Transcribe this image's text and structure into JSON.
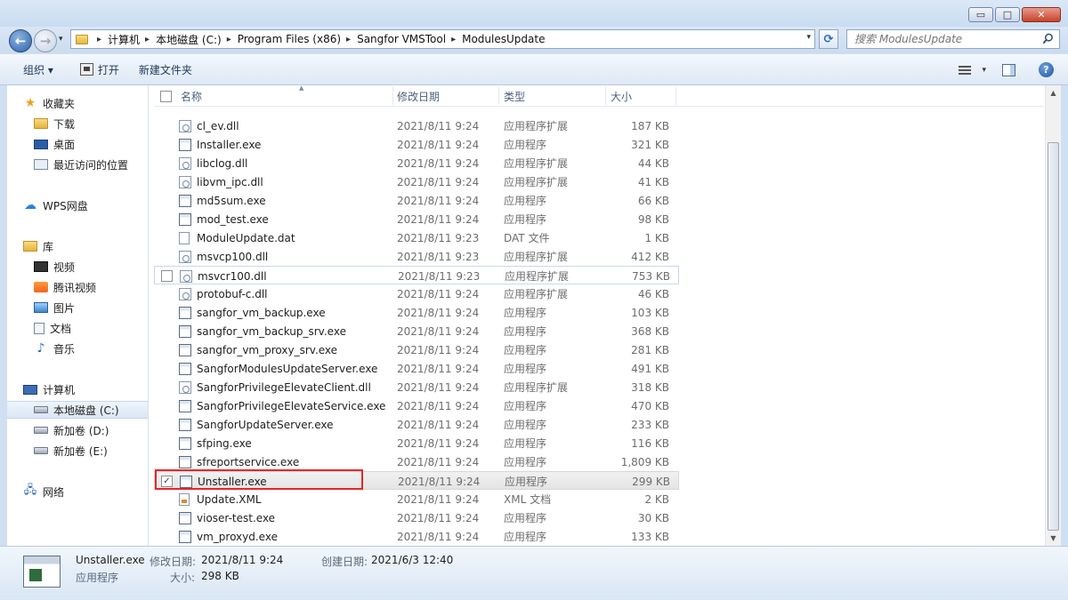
{
  "window": {
    "buttons": {
      "minimize": "▭",
      "maximize": "□",
      "close": "✕"
    }
  },
  "address": {
    "back": "←",
    "forward": "→",
    "breadcrumbs": [
      "计算机",
      "本地磁盘 (C:)",
      "Program Files (x86)",
      "Sangfor VMSTool",
      "ModulesUpdate"
    ],
    "refresh": "⟳",
    "search_placeholder": "搜索 ModulesUpdate"
  },
  "toolbar": {
    "organize": "组织 ▾",
    "open": "打开",
    "new_folder": "新建文件夹",
    "help": "?"
  },
  "sidebar": {
    "items": [
      {
        "label": "收藏夹"
      },
      {
        "label": "下载"
      },
      {
        "label": "桌面"
      },
      {
        "label": "最近访问的位置"
      },
      {
        "label": "WPS网盘"
      },
      {
        "label": "库"
      },
      {
        "label": "视频"
      },
      {
        "label": "腾讯视频"
      },
      {
        "label": "图片"
      },
      {
        "label": "文档"
      },
      {
        "label": "音乐"
      },
      {
        "label": "计算机"
      },
      {
        "label": "本地磁盘 (C:)"
      },
      {
        "label": "新加卷 (D:)"
      },
      {
        "label": "新加卷 (E:)"
      },
      {
        "label": "网络"
      }
    ]
  },
  "columns": {
    "name": "名称",
    "date": "修改日期",
    "type": "类型",
    "size": "大小"
  },
  "files": [
    {
      "name": "cl_ev.dll",
      "date": "2021/8/11 9:24",
      "type": "应用程序扩展",
      "size": "187 KB",
      "icon": "dll"
    },
    {
      "name": "Installer.exe",
      "date": "2021/8/11 9:24",
      "type": "应用程序",
      "size": "321 KB",
      "icon": "exe"
    },
    {
      "name": "libclog.dll",
      "date": "2021/8/11 9:24",
      "type": "应用程序扩展",
      "size": "44 KB",
      "icon": "dll"
    },
    {
      "name": "libvm_ipc.dll",
      "date": "2021/8/11 9:24",
      "type": "应用程序扩展",
      "size": "41 KB",
      "icon": "dll"
    },
    {
      "name": "md5sum.exe",
      "date": "2021/8/11 9:24",
      "type": "应用程序",
      "size": "66 KB",
      "icon": "exe"
    },
    {
      "name": "mod_test.exe",
      "date": "2021/8/11 9:24",
      "type": "应用程序",
      "size": "98 KB",
      "icon": "exe"
    },
    {
      "name": "ModuleUpdate.dat",
      "date": "2021/8/11 9:23",
      "type": "DAT 文件",
      "size": "1 KB",
      "icon": "dat"
    },
    {
      "name": "msvcp100.dll",
      "date": "2021/8/11 9:23",
      "type": "应用程序扩展",
      "size": "412 KB",
      "icon": "dll"
    },
    {
      "name": "msvcr100.dll",
      "date": "2021/8/11 9:23",
      "type": "应用程序扩展",
      "size": "753 KB",
      "icon": "dll"
    },
    {
      "name": "protobuf-c.dll",
      "date": "2021/8/11 9:24",
      "type": "应用程序扩展",
      "size": "46 KB",
      "icon": "dll"
    },
    {
      "name": "sangfor_vm_backup.exe",
      "date": "2021/8/11 9:24",
      "type": "应用程序",
      "size": "103 KB",
      "icon": "exe"
    },
    {
      "name": "sangfor_vm_backup_srv.exe",
      "date": "2021/8/11 9:24",
      "type": "应用程序",
      "size": "368 KB",
      "icon": "exe"
    },
    {
      "name": "sangfor_vm_proxy_srv.exe",
      "date": "2021/8/11 9:24",
      "type": "应用程序",
      "size": "281 KB",
      "icon": "exe"
    },
    {
      "name": "SangforModulesUpdateServer.exe",
      "date": "2021/8/11 9:24",
      "type": "应用程序",
      "size": "491 KB",
      "icon": "exe"
    },
    {
      "name": "SangforPrivilegeElevateClient.dll",
      "date": "2021/8/11 9:24",
      "type": "应用程序扩展",
      "size": "318 KB",
      "icon": "dll"
    },
    {
      "name": "SangforPrivilegeElevateService.exe",
      "date": "2021/8/11 9:24",
      "type": "应用程序",
      "size": "470 KB",
      "icon": "exe"
    },
    {
      "name": "SangforUpdateServer.exe",
      "date": "2021/8/11 9:24",
      "type": "应用程序",
      "size": "233 KB",
      "icon": "exe"
    },
    {
      "name": "sfping.exe",
      "date": "2021/8/11 9:24",
      "type": "应用程序",
      "size": "116 KB",
      "icon": "exe"
    },
    {
      "name": "sfreportservice.exe",
      "date": "2021/8/11 9:24",
      "type": "应用程序",
      "size": "1,809 KB",
      "icon": "exe"
    },
    {
      "name": "Unstaller.exe",
      "date": "2021/8/11 9:24",
      "type": "应用程序",
      "size": "299 KB",
      "icon": "exe"
    },
    {
      "name": "Update.XML",
      "date": "2021/8/11 9:24",
      "type": "XML 文档",
      "size": "2 KB",
      "icon": "xml"
    },
    {
      "name": "vioser-test.exe",
      "date": "2021/8/11 9:24",
      "type": "应用程序",
      "size": "30 KB",
      "icon": "exe"
    },
    {
      "name": "vm_proxyd.exe",
      "date": "2021/8/11 9:24",
      "type": "应用程序",
      "size": "133 KB",
      "icon": "exe"
    }
  ],
  "selected_check": "✓",
  "details": {
    "name": "Unstaller.exe",
    "modified_label": "修改日期:",
    "modified": "2021/8/11 9:24",
    "created_label": "创建日期:",
    "created": "2021/6/3 12:40",
    "type": "应用程序",
    "size_label": "大小:",
    "size": "298 KB"
  },
  "scrollbar": {
    "up": "▲",
    "down": "▼"
  }
}
